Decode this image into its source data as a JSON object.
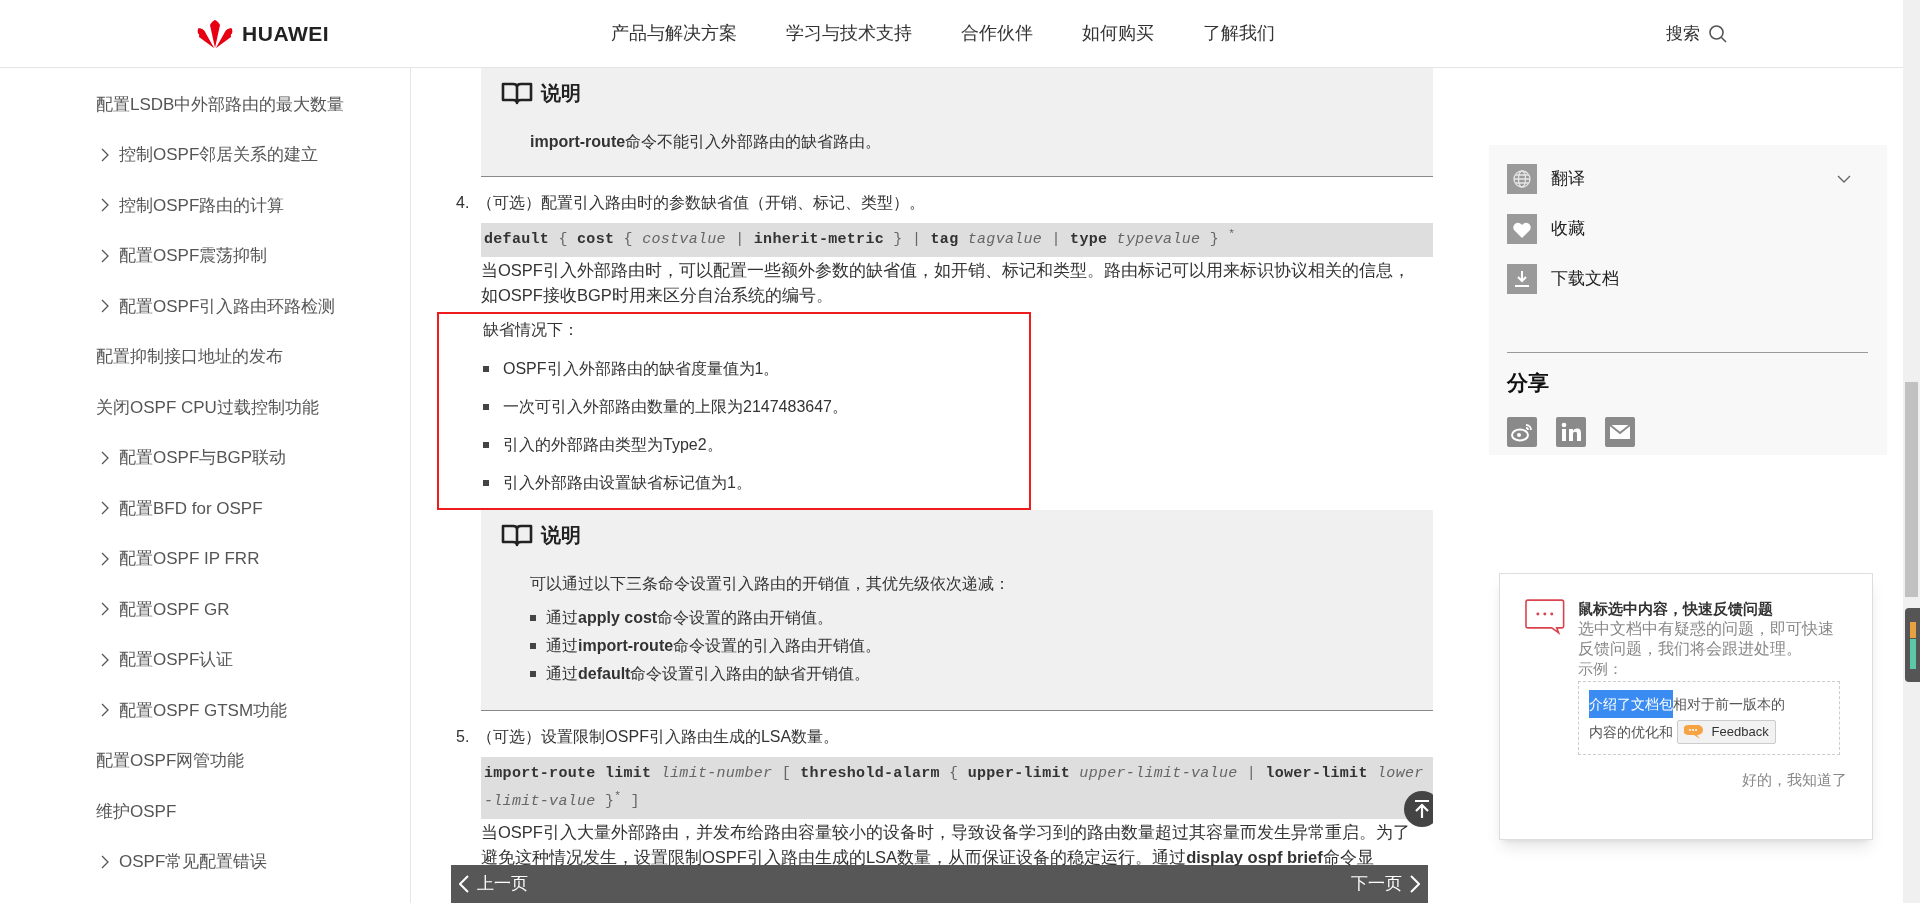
{
  "header": {
    "logo": "HUAWEI",
    "nav": [
      "产品与解决方案",
      "学习与技术支持",
      "合作伙伴",
      "如何购买",
      "了解我们"
    ],
    "search": "搜索"
  },
  "sidebar": {
    "items": [
      {
        "label": "配置LSDB中外部路由的最大数量",
        "expandable": false
      },
      {
        "label": "控制OSPF邻居关系的建立",
        "expandable": true
      },
      {
        "label": "控制OSPF路由的计算",
        "expandable": true
      },
      {
        "label": "配置OSPF震荡抑制",
        "expandable": true
      },
      {
        "label": "配置OSPF引入路由环路检测",
        "expandable": true
      },
      {
        "label": "配置抑制接口地址的发布",
        "expandable": false
      },
      {
        "label": "关闭OSPF CPU过载控制功能",
        "expandable": false
      },
      {
        "label": "配置OSPF与BGP联动",
        "expandable": true
      },
      {
        "label": "配置BFD for OSPF",
        "expandable": true
      },
      {
        "label": "配置OSPF IP FRR",
        "expandable": true
      },
      {
        "label": "配置OSPF GR",
        "expandable": true
      },
      {
        "label": "配置OSPF认证",
        "expandable": true
      },
      {
        "label": "配置OSPF GTSM功能",
        "expandable": true
      },
      {
        "label": "配置OSPF网管功能",
        "expandable": false
      },
      {
        "label": "维护OSPF",
        "expandable": false
      },
      {
        "label": "OSPF常见配置错误",
        "expandable": true
      }
    ]
  },
  "content": [
    {
      "kind": "note",
      "title": "说明",
      "text": "**import-route**命令不能引入外部路由的缺省路由。"
    },
    {
      "kind": "step",
      "number": "4.",
      "text": "（可选）配置引入路由时的参数缺省值（开销、标记、类型）。"
    },
    {
      "kind": "code",
      "text": "**default** { **cost** { *costvalue* | **inherit-metric** } | **tag** *tagvalue* | **type** *typevalue* } $^{*}$"
    },
    {
      "kind": "paragraph",
      "text": "当OSPF引入外部路由时，可以配置一些额外参数的缺省值，如开销、标记和类型。路由标记可以用来标识协议相关的信息，如OSPF接收BGP时用来区分自治系统的编号。"
    },
    {
      "kind": "defaults",
      "highlighted": true,
      "title": "缺省情况下：",
      "items": [
        "OSPF引入外部路由的缺省度量值为1。",
        "一次可引入外部路由数量的上限为2147483647。",
        "引入的外部路由类型为Type2。",
        "引入外部路由设置缺省标记值为1。"
      ]
    },
    {
      "kind": "note",
      "title": "说明",
      "text": "可以通过以下三条命令设置引入路由的开销值，其优先级依次递减：",
      "items": [
        "通过**apply cost**命令设置的路由开销值。",
        "通过**import-route**命令设置的引入路由开销值。",
        "通过**default**命令设置引入路由的缺省开销值。"
      ]
    },
    {
      "kind": "step",
      "number": "5.",
      "text": "（可选）设置限制OSPF引入路由生成的LSA数量。"
    },
    {
      "kind": "code",
      "text": "**import-route limit** *limit-number* [ **threshold-alarm** { **upper-limit** *upper-limit-value* | **lower-limit** *lower-limit-value* }$^{*}$ ]"
    },
    {
      "kind": "paragraph",
      "text": "当OSPF引入大量外部路由，并发布给路由容量较小的设备时，导致设备学习到的路由数量超过其容量而发生异常重启。为了避免这种情况发生，设置限制OSPF引入路由生成的LSA数量，从而保证设备的稳定运行。通过**display ospf brief**命令显"
    }
  ],
  "pager": {
    "previous": "上一页",
    "next": "下一页"
  },
  "actions": [
    {
      "kind": "translate",
      "label": "翻译",
      "expandable": true
    },
    {
      "kind": "favorite",
      "label": "收藏",
      "expandable": false
    },
    {
      "kind": "download",
      "label": "下载文档",
      "expandable": false
    }
  ],
  "share": {
    "title": "分享"
  },
  "feedback_tip": {
    "title": "鼠标选中内容，快速反馈问题",
    "text": "选中文档中有疑惑的问题，即可快速反馈问题，我们将会跟进处理。",
    "example_label": "示例：",
    "example_selected": "介绍了文档包",
    "example_rest_1": "相对于前一版本的",
    "example_rest_2": "内容的优化和",
    "example_button": "Feedback",
    "dismiss": "好的，我知道了"
  }
}
